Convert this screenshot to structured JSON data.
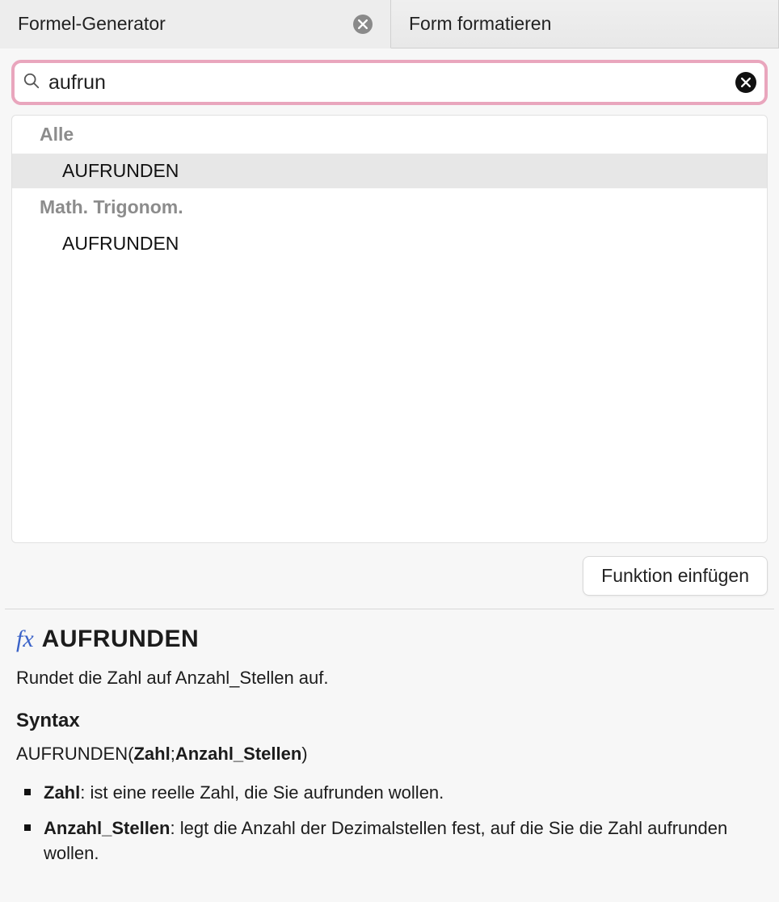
{
  "tabs": {
    "active": "Formel-Generator",
    "inactive": "Form formatieren"
  },
  "search": {
    "value": "aufrun"
  },
  "results": {
    "categories": [
      {
        "label": "Alle",
        "items": [
          "AUFRUNDEN"
        ],
        "selectedIndex": 0
      },
      {
        "label": "Math.  Trigonom.",
        "items": [
          "AUFRUNDEN"
        ],
        "selectedIndex": -1
      }
    ]
  },
  "insertButton": "Funktion einfügen",
  "help": {
    "fnName": "AUFRUNDEN",
    "description": "Rundet die Zahl auf Anzahl_Stellen auf.",
    "syntaxHeading": "Syntax",
    "syntaxFn": "AUFRUNDEN",
    "syntaxArg1": "Zahl",
    "syntaxArg2": "Anzahl_Stellen",
    "arguments": [
      {
        "name": "Zahl",
        "desc": ": ist eine reelle Zahl, die Sie aufrunden wollen."
      },
      {
        "name": "Anzahl_Stellen",
        "desc": ": legt die Anzahl der Dezimalstellen fest, auf die Sie die Zahl aufrunden wollen."
      }
    ]
  }
}
